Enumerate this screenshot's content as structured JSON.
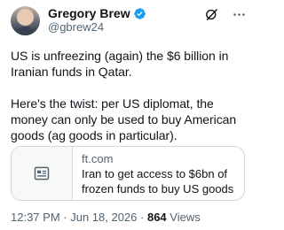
{
  "author": {
    "display_name": "Gregory Brew",
    "handle": "@gbrew24",
    "verified": true,
    "avatar_icon": "profile-photo"
  },
  "header_actions": {
    "grok_icon": "grok-icon",
    "more_icon": "more-icon"
  },
  "tweet": {
    "text": "US is unfreezing (again) the $6 billion in Iranian funds in Qatar.\n\nHere's the twist: per US diplomat, the money can only be used to buy American goods (ag goods in particular)."
  },
  "link_card": {
    "icon": "article-icon",
    "domain": "ft.com",
    "title": "Iran to get access to $6bn of\nfrozen funds to buy US goods"
  },
  "meta": {
    "time": "12:37 PM",
    "separator": " · ",
    "date": "Jun 18, 2026",
    "separator2": " · ",
    "views_count": "864",
    "views_label": " Views"
  },
  "colors": {
    "verified_blue": "#1d9bf0",
    "secondary_text": "#536471",
    "primary_text": "#0f1419",
    "border": "#cfd9de"
  }
}
